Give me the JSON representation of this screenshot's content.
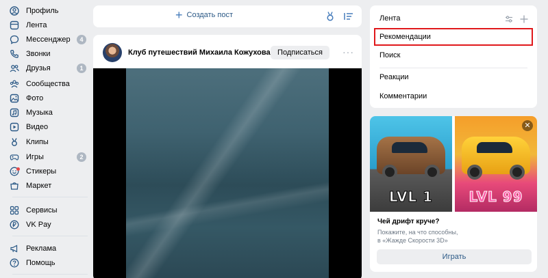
{
  "sidebar": {
    "items": [
      {
        "label": "Профиль",
        "icon": "user-circle-icon"
      },
      {
        "label": "Лента",
        "icon": "news-feed-icon"
      },
      {
        "label": "Мессенджер",
        "icon": "message-icon",
        "badge": "4"
      },
      {
        "label": "Звонки",
        "icon": "phone-icon"
      },
      {
        "label": "Друзья",
        "icon": "friends-icon",
        "badge": "1"
      },
      {
        "label": "Сообщества",
        "icon": "communities-icon"
      },
      {
        "label": "Фото",
        "icon": "photo-icon"
      },
      {
        "label": "Музыка",
        "icon": "music-icon"
      },
      {
        "label": "Видео",
        "icon": "video-icon"
      },
      {
        "label": "Клипы",
        "icon": "clips-icon"
      },
      {
        "label": "Игры",
        "icon": "games-icon",
        "badge": "2"
      },
      {
        "label": "Стикеры",
        "icon": "stickers-icon"
      },
      {
        "label": "Маркет",
        "icon": "market-icon"
      },
      {
        "label": "Сервисы",
        "icon": "services-icon"
      },
      {
        "label": "VK Pay",
        "icon": "vkpay-icon"
      },
      {
        "label": "Реклама",
        "icon": "ads-icon"
      },
      {
        "label": "Помощь",
        "icon": "help-icon"
      }
    ]
  },
  "create_post": {
    "label": "Создать пост"
  },
  "post": {
    "author": "Клуб путешествий Михаила Кожухова",
    "subscribe_label": "Подписаться",
    "more_label": "···"
  },
  "feed_menu": {
    "items": [
      {
        "label": "Лента"
      },
      {
        "label": "Рекомендации",
        "active": true
      },
      {
        "label": "Поиск"
      },
      {
        "label": "Реакции"
      },
      {
        "label": "Комментарии"
      }
    ]
  },
  "ad": {
    "left_level": "LVL 1",
    "right_level": "LVL 99",
    "title": "Чей дрифт круче?",
    "desc_line1": "Покажите, на что способны,",
    "desc_line2": "в «Жажде Скорости 3D»",
    "button_label": "Играть",
    "close_label": "✕"
  },
  "colors": {
    "accent": "#2a5885",
    "background": "#edeef0",
    "highlight": "#e0171a"
  }
}
